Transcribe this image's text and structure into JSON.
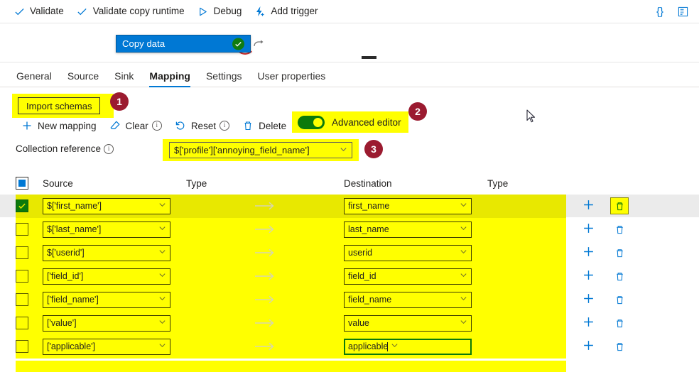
{
  "toolbar": {
    "items": [
      {
        "label": "Validate",
        "icon": "checkmark-icon"
      },
      {
        "label": "Validate copy runtime",
        "icon": "checkmark-icon"
      },
      {
        "label": "Debug",
        "icon": "play-triangle-icon"
      },
      {
        "label": "Add trigger",
        "icon": "lightning-plus-icon"
      }
    ],
    "right_icons": [
      {
        "name": "code-braces-icon",
        "glyph": "{}"
      },
      {
        "name": "properties-panel-icon",
        "glyph": ""
      }
    ]
  },
  "canvas": {
    "activity": {
      "name": "Copy data",
      "status_icon": "green-check-badge",
      "side_icon": "rerun-arrow-icon"
    }
  },
  "tabs": [
    {
      "label": "General",
      "active": false
    },
    {
      "label": "Source",
      "active": false
    },
    {
      "label": "Sink",
      "active": false
    },
    {
      "label": "Mapping",
      "active": true
    },
    {
      "label": "Settings",
      "active": false
    },
    {
      "label": "User properties",
      "active": false
    }
  ],
  "mapping_actions": {
    "import_schemas": "Import schemas",
    "new_mapping": "New mapping",
    "clear": "Clear",
    "reset": "Reset",
    "delete": "Delete",
    "advanced_editor": "Advanced editor",
    "advanced_editor_on": true
  },
  "annotations": [
    {
      "number": "1",
      "target": "import-schemas-button"
    },
    {
      "number": "2",
      "target": "advanced-editor-toggle"
    },
    {
      "number": "3",
      "target": "collection-reference-field"
    }
  ],
  "collection_reference": {
    "label": "Collection reference",
    "value": "$['profile']['annoying_field_name']"
  },
  "table": {
    "headers": {
      "source": "Source",
      "type1": "Type",
      "destination": "Destination",
      "type2": "Type"
    },
    "rows": [
      {
        "checked": true,
        "source": "$['first_name']",
        "type1": "",
        "destination": "first_name",
        "type2": "",
        "hovered": true,
        "focused": false
      },
      {
        "checked": false,
        "source": "$['last_name']",
        "type1": "",
        "destination": "last_name",
        "type2": "",
        "hovered": false,
        "focused": false
      },
      {
        "checked": false,
        "source": "$['userid']",
        "type1": "",
        "destination": "userid",
        "type2": "",
        "hovered": false,
        "focused": false
      },
      {
        "checked": false,
        "source": "['field_id']",
        "type1": "",
        "destination": "field_id",
        "type2": "",
        "hovered": false,
        "focused": false
      },
      {
        "checked": false,
        "source": "['field_name']",
        "type1": "",
        "destination": "field_name",
        "type2": "",
        "hovered": false,
        "focused": false
      },
      {
        "checked": false,
        "source": "['value']",
        "type1": "",
        "destination": "value",
        "type2": "",
        "hovered": false,
        "focused": false
      },
      {
        "checked": false,
        "source": "['applicable']",
        "type1": "",
        "destination": "applicable",
        "type2": "",
        "hovered": false,
        "focused": true
      }
    ]
  },
  "colors": {
    "accent": "#0078d4",
    "highlight": "#ffff00",
    "badge": "#9b1b30",
    "toggle_on": "#0b7a0b",
    "success": "#107c10"
  }
}
